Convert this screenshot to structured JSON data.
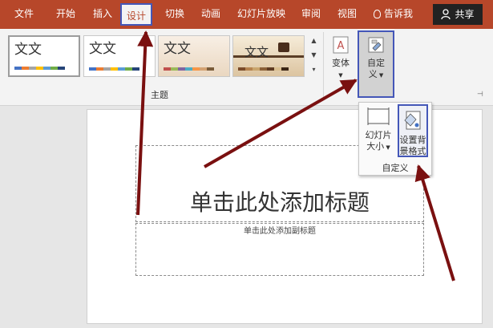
{
  "tabs": [
    {
      "label": "文件"
    },
    {
      "label": "开始"
    },
    {
      "label": "插入"
    },
    {
      "label": "设计"
    },
    {
      "label": "切换"
    },
    {
      "label": "动画"
    },
    {
      "label": "幻灯片放映"
    },
    {
      "label": "审阅"
    },
    {
      "label": "视图"
    }
  ],
  "active_tab": "设计",
  "tell_me": "告诉我",
  "share": "共享",
  "themes": {
    "items": [
      {
        "label": "文文"
      },
      {
        "label": "文文"
      },
      {
        "label": "文文"
      },
      {
        "label": "文文"
      }
    ],
    "group_label": "主题"
  },
  "variants": {
    "label": "变体"
  },
  "customize": {
    "label_line1": "自定",
    "label_line2": "义"
  },
  "customize_panel": {
    "slide_size_line1": "幻灯片",
    "slide_size_line2": "大小",
    "format_bg_line1": "设置背",
    "format_bg_line2": "景格式",
    "group_label": "自定义"
  },
  "slide": {
    "title_placeholder": "单击此处添加标题",
    "subtitle_placeholder": "单击此处添加副标题"
  },
  "colors": {
    "ribbon_accent": "#b7472a",
    "highlight_box": "#4457b8",
    "annotation_arrow": "#7a1010"
  }
}
